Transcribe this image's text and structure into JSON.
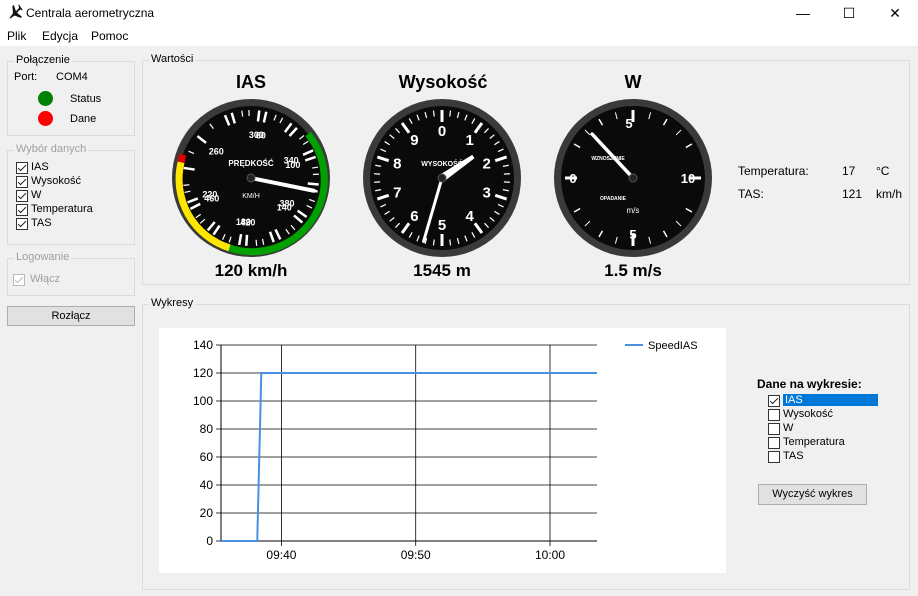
{
  "window": {
    "title": "Centrala aerometryczna",
    "minimize": "—",
    "maximize": "☐",
    "close": "✕"
  },
  "menu": [
    "Plik",
    "Edycja",
    "Pomoc"
  ],
  "connection": {
    "group_label": "Połączenie",
    "port_label": "Port:",
    "port_value": "COM4",
    "status_label": "Status",
    "status_color": "#008000",
    "data_label": "Dane",
    "data_color": "#ff0000"
  },
  "data_selection": {
    "group_label": "Wybór danych",
    "items": [
      {
        "label": "IAS",
        "checked": true
      },
      {
        "label": "Wysokość",
        "checked": true
      },
      {
        "label": "W",
        "checked": true
      },
      {
        "label": "Temperatura",
        "checked": true
      },
      {
        "label": "TAS",
        "checked": true
      }
    ]
  },
  "logging": {
    "group_label": "Logowanie",
    "enable_label": "Włącz",
    "checked": true
  },
  "disconnect_button": "Rozłącz",
  "values": {
    "group_label": "Wartości",
    "ias": {
      "title": "IAS",
      "value_text": "120 km/h",
      "value": 120,
      "dial_caption": "PRĘDKOŚĆ",
      "dial_unit": "KM/H",
      "scale_labels": [
        "60",
        "100",
        "140",
        "180",
        "220",
        "260",
        "300",
        "340",
        "380",
        "420",
        "460"
      ]
    },
    "altitude": {
      "title": "Wysokość",
      "value_text": "1545 m",
      "value": 1545,
      "dial_caption": "WYSOKOŚĆ",
      "scale_labels": [
        "0",
        "1",
        "2",
        "3",
        "4",
        "5",
        "6",
        "7",
        "8",
        "9"
      ]
    },
    "vario": {
      "title": "W",
      "value_text": "1.5 m/s",
      "value": 1.5,
      "climb_caption": "WZNOSZENIE",
      "sink_caption": "OPADANIE",
      "dial_unit": "m/s",
      "scale_labels": [
        "0",
        "5",
        "10",
        "5"
      ]
    },
    "temperature": {
      "label": "Temperatura:",
      "value": "17",
      "unit": "°C"
    },
    "tas": {
      "label": "TAS:",
      "value": "121",
      "unit": "km/h"
    }
  },
  "charts": {
    "group_label": "Wykresy",
    "series_panel_title": "Dane na wykresie:",
    "series_options": [
      {
        "label": "IAS",
        "checked": true,
        "selected": true
      },
      {
        "label": "Wysokość",
        "checked": false,
        "selected": false
      },
      {
        "label": "W",
        "checked": false,
        "selected": false
      },
      {
        "label": "Temperatura",
        "checked": false,
        "selected": false
      },
      {
        "label": "TAS",
        "checked": false,
        "selected": false
      }
    ],
    "clear_button": "Wyczyść wykres",
    "selection_color": "#0078d7"
  },
  "chart_data": {
    "type": "line",
    "title": "",
    "xlabel": "",
    "ylabel": "",
    "ylim": [
      0,
      140
    ],
    "yticks": [
      0,
      20,
      40,
      60,
      80,
      100,
      120,
      140
    ],
    "x_tick_labels": [
      "09:40",
      "09:50",
      "10:00"
    ],
    "x_tick_minutes": [
      40,
      50,
      60
    ],
    "xlim_minutes": [
      35.5,
      63.5
    ],
    "legend_position": "top-right",
    "series": [
      {
        "name": "SpeedIAS",
        "color": "#4a90e2",
        "x_minutes": [
          35.5,
          38.2,
          38.5,
          63.5
        ],
        "values": [
          0,
          0,
          120,
          120
        ]
      }
    ]
  }
}
